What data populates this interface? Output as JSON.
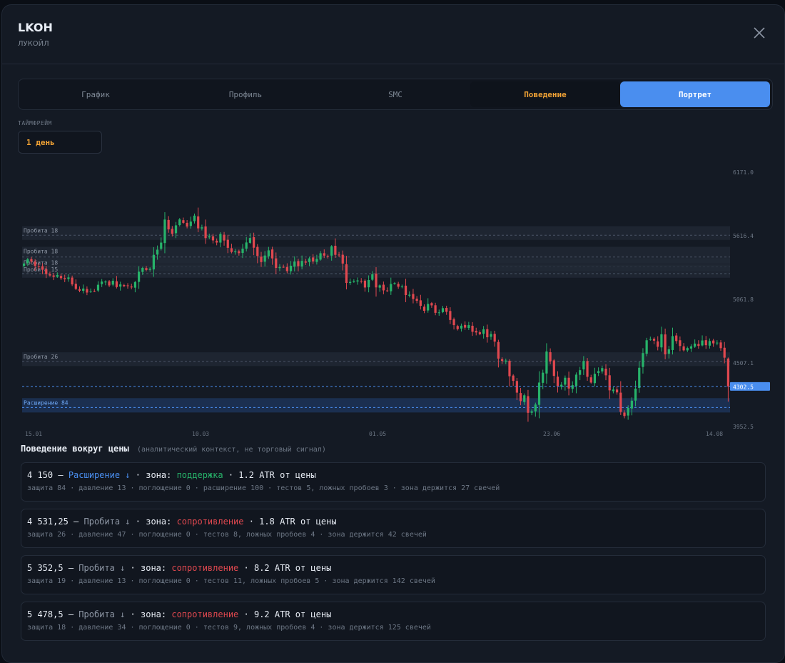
{
  "header": {
    "ticker": "LKOH",
    "company": "ЛУКОЙЛ"
  },
  "tabs": [
    {
      "label": "График"
    },
    {
      "label": "Профиль"
    },
    {
      "label": "SMC"
    },
    {
      "label": "Поведение"
    },
    {
      "label": "Портрет"
    }
  ],
  "active_tab": "Портрет",
  "timeframe": {
    "label": "ТАЙМФРЕЙМ",
    "value": "1 день"
  },
  "colors": {
    "bull": "#27b36a",
    "bear": "#e0484f",
    "accent": "#4a8eef",
    "orange": "#f0a235",
    "background": "#141a24"
  },
  "icons": {
    "close": "close-icon"
  },
  "chart_data": {
    "type": "candlestick",
    "y_ticks": [
      "6171.0",
      "5616.4",
      "5061.8",
      "4507.1",
      "3952.5"
    ],
    "ylim": [
      3952.5,
      6171.0
    ],
    "x_ticks": [
      "15.01",
      "10.03",
      "01.05",
      "23.06",
      "14.08"
    ],
    "current_price": "4302.5",
    "zones": [
      {
        "label": "Пробита 18",
        "low": 5580,
        "high": 5700,
        "type": "broken"
      },
      {
        "label": "Пробита 18",
        "low": 5380,
        "high": 5520,
        "type": "broken"
      },
      {
        "label": "Пробита 18",
        "low": 5310,
        "high": 5420,
        "type": "broken"
      },
      {
        "label": "Пробита 15",
        "low": 5250,
        "high": 5360,
        "type": "broken"
      },
      {
        "label": "Пробита 26",
        "low": 4480,
        "high": 4600,
        "type": "broken"
      },
      {
        "label": "Расширение 84",
        "low": 4075,
        "high": 4200,
        "type": "expansion"
      }
    ],
    "close_series": [
      5374,
      5412,
      5392,
      5353,
      5345,
      5320,
      5282,
      5270,
      5258,
      5274,
      5246,
      5237,
      5253,
      5192,
      5153,
      5137,
      5156,
      5121,
      5131,
      5133,
      5189,
      5217,
      5217,
      5183,
      5224,
      5169,
      5192,
      5177,
      5179,
      5166,
      5213,
      5303,
      5336,
      5318,
      5329,
      5450,
      5495,
      5557,
      5758,
      5672,
      5633,
      5707,
      5759,
      5729,
      5697,
      5740,
      5792,
      5681,
      5690,
      5596,
      5612,
      5576,
      5557,
      5632,
      5575,
      5511,
      5475,
      5480,
      5465,
      5504,
      5558,
      5597,
      5512,
      5440,
      5387,
      5444,
      5489,
      5419,
      5336,
      5344,
      5345,
      5308,
      5355,
      5392,
      5351,
      5397,
      5382,
      5419,
      5392,
      5415,
      5464,
      5443,
      5440,
      5525,
      5450,
      5449,
      5374,
      5205,
      5214,
      5223,
      5227,
      5218,
      5165,
      5230,
      5281,
      5166,
      5184,
      5140,
      5136,
      5196,
      5204,
      5172,
      5175,
      5099,
      5102,
      5065,
      5049,
      5005,
      4962,
      5022,
      5009,
      4944,
      4948,
      4985,
      4953,
      4882,
      4837,
      4802,
      4832,
      4815,
      4837,
      4779,
      4773,
      4758,
      4800,
      4731,
      4759,
      4693,
      4545,
      4525,
      4528,
      4391,
      4351,
      4248,
      4174,
      4225,
      4072,
      4085,
      4144,
      4336,
      4422,
      4607,
      4522,
      4394,
      4304,
      4317,
      4378,
      4284,
      4313,
      4405,
      4444,
      4524,
      4386,
      4336,
      4412,
      4436,
      4462,
      4399,
      4268,
      4275,
      4250,
      4080,
      4044,
      4115,
      4178,
      4283,
      4465,
      4593,
      4705,
      4715,
      4701,
      4648,
      4757,
      4582,
      4626,
      4741,
      4698,
      4655,
      4617,
      4637,
      4652,
      4676,
      4656,
      4703,
      4662,
      4698,
      4678,
      4684,
      4636,
      4553,
      4302
    ]
  },
  "behavior": {
    "title": "Поведение вокруг цены",
    "subtitle": "(аналитический контекст, не торговый сигнал)",
    "zones": [
      {
        "price": "4 150",
        "dash": "—",
        "kind": "Расширение ↓",
        "kind_class": "c-exp",
        "sep1": "· зона:",
        "role": "поддержка",
        "role_class": "c-sup",
        "distance": "· 1.2 ATR от цены",
        "details": "защита 84 · давление 13 · поглощение 0 · расширение 100 · тестов 5, ложных пробоев 3 · зона держится 27 свечей"
      },
      {
        "price": "4 531,25",
        "dash": "—",
        "kind": "Пробита ↓",
        "kind_class": "c-brk",
        "sep1": "· зона:",
        "role": "сопротивление",
        "role_class": "c-res",
        "distance": "· 1.8 ATR от цены",
        "details": "защита 26 · давление 47 · поглощение 0 · тестов 8, ложных пробоев 4 · зона держится 42 свечей"
      },
      {
        "price": "5 352,5",
        "dash": "—",
        "kind": "Пробита ↓",
        "kind_class": "c-brk",
        "sep1": "· зона:",
        "role": "сопротивление",
        "role_class": "c-res",
        "distance": "· 8.2 ATR от цены",
        "details": "защита 19 · давление 13 · поглощение 0 · тестов 11, ложных пробоев 5 · зона держится 142 свечей"
      },
      {
        "price": "5 478,5",
        "dash": "—",
        "kind": "Пробита ↓",
        "kind_class": "c-brk",
        "sep1": "· зона:",
        "role": "сопротивление",
        "role_class": "c-res",
        "distance": "· 9.2 ATR от цены",
        "details": "защита 18 · давление 34 · поглощение 0 · тестов 9, ложных пробоев 4 · зона держится 125 свечей"
      }
    ]
  }
}
